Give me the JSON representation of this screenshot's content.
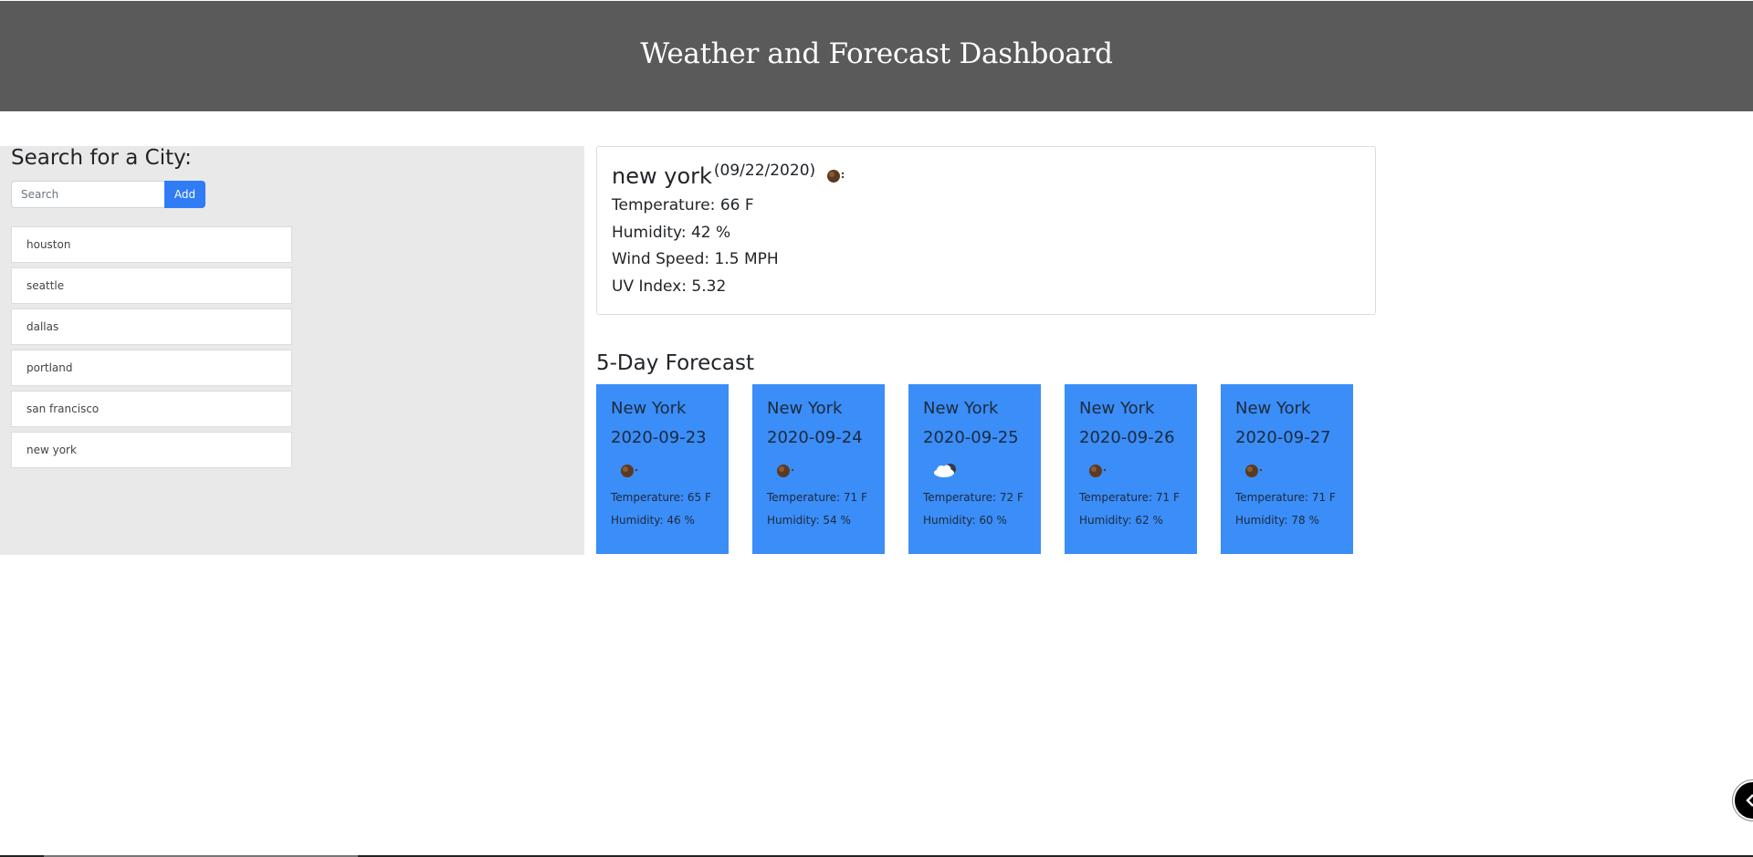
{
  "header": {
    "title": "Weather and Forecast Dashboard"
  },
  "sidebar": {
    "heading": "Search for a City:",
    "search_placeholder": "Search",
    "add_label": "Add",
    "cities": [
      "houston",
      "seattle",
      "dallas",
      "portland",
      "san francisco",
      "new york"
    ]
  },
  "current": {
    "city": "new york",
    "date": "(09/22/2020)",
    "icon": "clear-sky-icon",
    "temperature": "Temperature: 66 F",
    "humidity": "Humidity: 42 %",
    "wind": "Wind Speed: 1.5 MPH",
    "uv": "UV Index: 5.32"
  },
  "forecast": {
    "title": "5-Day Forecast",
    "days": [
      {
        "city": "New York",
        "date": "2020-09-23",
        "icon": "clear-sky-icon",
        "temp": "Temperature: 65 F",
        "humidity": "Humidity: 46 %"
      },
      {
        "city": "New York",
        "date": "2020-09-24",
        "icon": "clear-sky-icon",
        "temp": "Temperature: 71 F",
        "humidity": "Humidity: 54 %"
      },
      {
        "city": "New York",
        "date": "2020-09-25",
        "icon": "cloudy-icon",
        "temp": "Temperature: 72 F",
        "humidity": "Humidity: 60 %"
      },
      {
        "city": "New York",
        "date": "2020-09-26",
        "icon": "clear-sky-icon",
        "temp": "Temperature: 71 F",
        "humidity": "Humidity: 62 %"
      },
      {
        "city": "New York",
        "date": "2020-09-27",
        "icon": "clear-sky-icon",
        "temp": "Temperature: 71 F",
        "humidity": "Humidity: 78 %"
      }
    ]
  },
  "colors": {
    "header_bg": "#5a5a5a",
    "sidebar_bg": "#e9e9e9",
    "card_bg": "#3b8df8",
    "button_bg": "#2f7cf6"
  }
}
